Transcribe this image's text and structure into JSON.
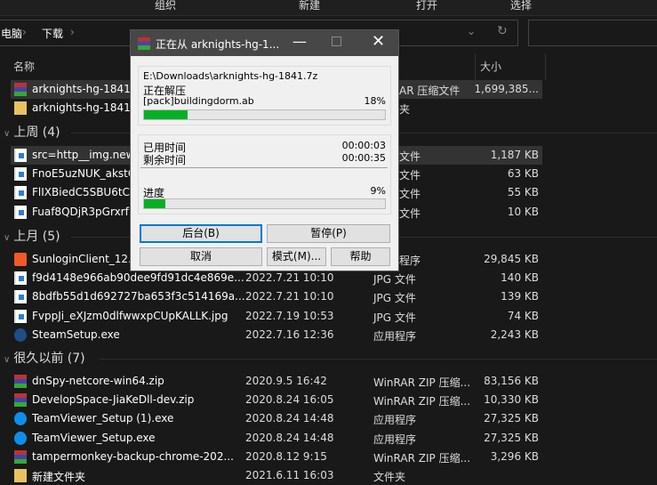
{
  "ribbon": [
    "组织",
    "新建",
    "打开",
    "选择"
  ],
  "breadcrumb": [
    "电脑",
    "下载"
  ],
  "columns": {
    "name": "名称",
    "size": "大小"
  },
  "top_rows": [
    {
      "name": "arknights-hg-1841.",
      "type": "AR 压缩文件",
      "size": "1,699,385...",
      "icon": "rar"
    },
    {
      "name": "arknights-hg-1841",
      "type": "夹",
      "size": "",
      "icon": "folder"
    }
  ],
  "groups": [
    {
      "label": "上周 (4)",
      "rows": [
        {
          "name": "src=http__img.new",
          "date": "",
          "type": "文件",
          "size": "1,187 KB",
          "icon": "image"
        },
        {
          "name": "FnoE5uzNUK_akstC",
          "date": "",
          "type": "文件",
          "size": "63 KB",
          "icon": "image"
        },
        {
          "name": "FlIXBiedC5SBU6tCC",
          "date": "",
          "type": "文件",
          "size": "55 KB",
          "icon": "image"
        },
        {
          "name": "Fuaf8QDjR3pGrxrf7",
          "date": "",
          "type": "文件",
          "size": "10 KB",
          "icon": "image"
        }
      ]
    },
    {
      "label": "上月 (5)",
      "rows": [
        {
          "name": "SunloginClient_12.6",
          "date": "",
          "type": "程序",
          "size": "29,845 KB",
          "icon": "sunlogin"
        },
        {
          "name": "f9d4148e966ab90dee9fd91dc4e869e...",
          "date": "2022.7.21 10:10",
          "type": "JPG 文件",
          "size": "140 KB",
          "icon": "image"
        },
        {
          "name": "8bdfb55d1d692727ba653f3c514169a...",
          "date": "2022.7.21 10:10",
          "type": "JPG 文件",
          "size": "139 KB",
          "icon": "image"
        },
        {
          "name": "FvppJi_eXJzm0dlfwwxpCUpKALLK.jpg",
          "date": "2022.7.19 10:53",
          "type": "JPG 文件",
          "size": "74 KB",
          "icon": "image"
        },
        {
          "name": "SteamSetup.exe",
          "date": "2022.7.16 12:36",
          "type": "应用程序",
          "size": "2,243 KB",
          "icon": "steam"
        }
      ]
    },
    {
      "label": "很久以前 (7)",
      "rows": [
        {
          "name": "dnSpy-netcore-win64.zip",
          "date": "2020.9.5 16:42",
          "type": "WinRAR ZIP 压缩...",
          "size": "83,156 KB",
          "icon": "rar"
        },
        {
          "name": "DevelopSpace-JiaKeDll-dev.zip",
          "date": "2020.8.24 16:05",
          "type": "WinRAR ZIP 压缩...",
          "size": "10,330 KB",
          "icon": "rar"
        },
        {
          "name": "TeamViewer_Setup (1).exe",
          "date": "2020.8.24 14:48",
          "type": "应用程序",
          "size": "27,325 KB",
          "icon": "teamviewer"
        },
        {
          "name": "TeamViewer_Setup.exe",
          "date": "2020.8.24 14:48",
          "type": "应用程序",
          "size": "27,325 KB",
          "icon": "teamviewer"
        },
        {
          "name": "tampermonkey-backup-chrome-202...",
          "date": "2020.8.12 9:15",
          "type": "WinRAR ZIP 压缩...",
          "size": "3,296 KB",
          "icon": "rar"
        },
        {
          "name": "新建文件夹",
          "date": "2021.6.11 16:03",
          "type": "文件夹",
          "size": "",
          "icon": "folder"
        }
      ]
    }
  ],
  "dialog": {
    "title": "正在从 arknights-hg-1...",
    "archive": "E:\\Downloads\\arknights-hg-1841.7z",
    "action": "正在解压",
    "file": "[pack]buildingdorm.ab",
    "file_pct": "18%",
    "file_progress": 18,
    "elapsed_label": "已用时间",
    "elapsed": "00:00:03",
    "remain_label": "剩余时间",
    "remain": "00:00:35",
    "progress_label": "进度",
    "total_pct": "9%",
    "total_progress": 9,
    "buttons": {
      "background": "后台(B)",
      "pause": "暂停(P)",
      "cancel": "取消",
      "mode": "模式(M)...",
      "help": "帮助"
    }
  },
  "colors": {
    "progress": "#06b025",
    "bg": "#191919"
  }
}
